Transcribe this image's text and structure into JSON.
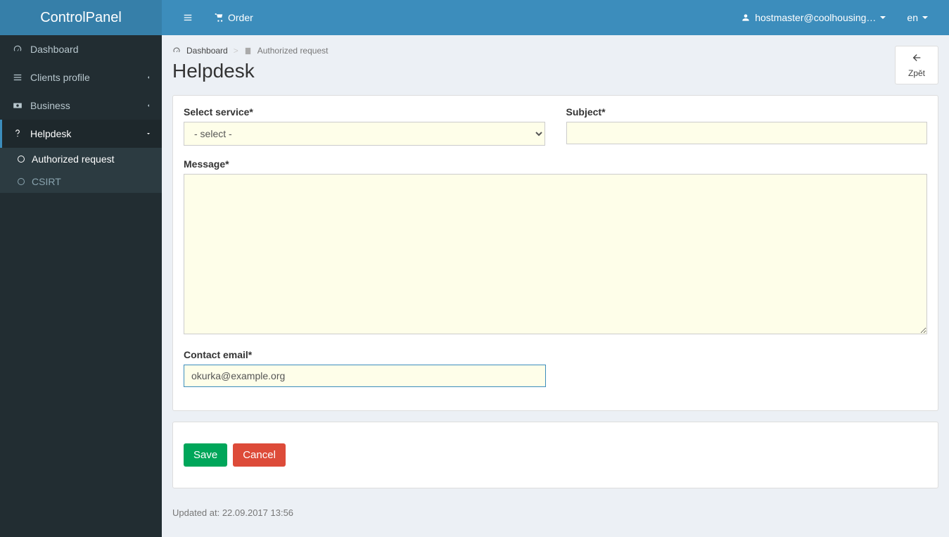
{
  "brand": "ControlPanel",
  "topbar": {
    "order_label": "Order",
    "user_display": "hostmaster@coolhousing… ",
    "lang": "en "
  },
  "sidebar": {
    "items": [
      {
        "label": "Dashboard"
      },
      {
        "label": "Clients profile"
      },
      {
        "label": "Business"
      },
      {
        "label": "Helpdesk"
      }
    ],
    "helpdesk_sub": [
      {
        "label": "Authorized request"
      },
      {
        "label": "CSIRT"
      }
    ]
  },
  "breadcrumb": {
    "root": "Dashboard",
    "current": "Authorized request"
  },
  "page": {
    "title": "Helpdesk",
    "back_label": "Zpět"
  },
  "form": {
    "service_label": "Select service*",
    "service_placeholder": "- select -",
    "subject_label": "Subject*",
    "subject_value": "",
    "message_label": "Message*",
    "message_value": "",
    "email_label": "Contact email*",
    "email_value": "okurka@example.org"
  },
  "actions": {
    "save": "Save",
    "cancel": "Cancel"
  },
  "footer": {
    "updated": "Updated at: 22.09.2017 13:56"
  }
}
